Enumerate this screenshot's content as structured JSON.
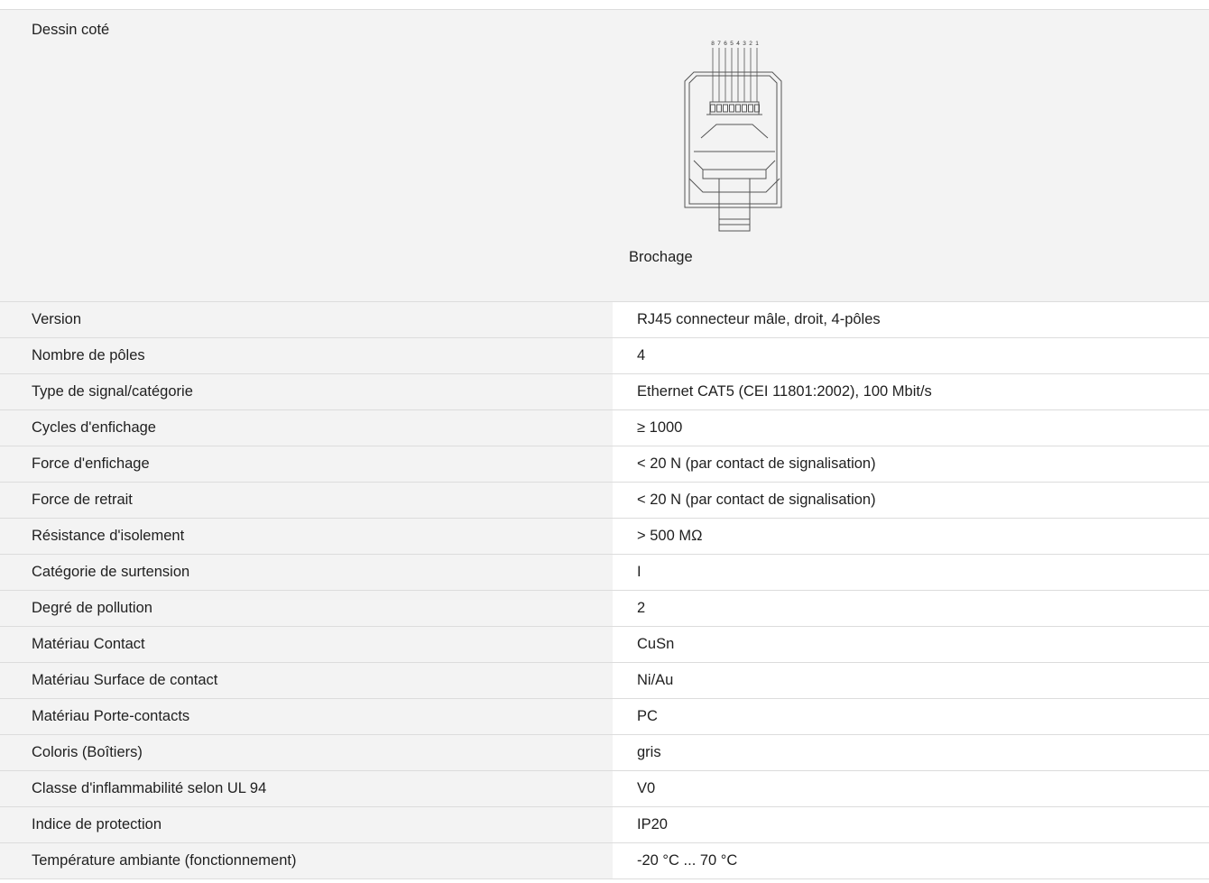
{
  "drawing_section": {
    "label": "Dessin coté",
    "caption": "Brochage",
    "pin_numbers": [
      "8",
      "7",
      "6",
      "5",
      "4",
      "3",
      "2",
      "1"
    ]
  },
  "specs": [
    {
      "label": "Version",
      "value": "RJ45 connecteur mâle, droit, 4-pôles"
    },
    {
      "label": "Nombre de pôles",
      "value": "4"
    },
    {
      "label": "Type de signal/catégorie",
      "value": "Ethernet CAT5 (CEI 11801:2002), 100 Mbit/s"
    },
    {
      "label": "Cycles d'enfichage",
      "value": "≥ 1000"
    },
    {
      "label": "Force d'enfichage",
      "value": "< 20 N (par contact de signalisation)"
    },
    {
      "label": "Force de retrait",
      "value": "< 20 N (par contact de signalisation)"
    },
    {
      "label": "Résistance d'isolement",
      "value": "> 500 MΩ"
    },
    {
      "label": "Catégorie de surtension",
      "value": "I"
    },
    {
      "label": "Degré de pollution",
      "value": "2"
    },
    {
      "label": "Matériau Contact",
      "value": "CuSn"
    },
    {
      "label": "Matériau Surface de contact",
      "value": "Ni/Au"
    },
    {
      "label": "Matériau Porte-contacts",
      "value": "PC"
    },
    {
      "label": "Coloris (Boîtiers)",
      "value": "gris"
    },
    {
      "label": "Classe d'inflammabilité selon UL 94",
      "value": "V0"
    },
    {
      "label": "Indice de protection",
      "value": "IP20"
    },
    {
      "label": "Température ambiante (fonctionnement)",
      "value": "-20 °C ... 70 °C"
    }
  ]
}
